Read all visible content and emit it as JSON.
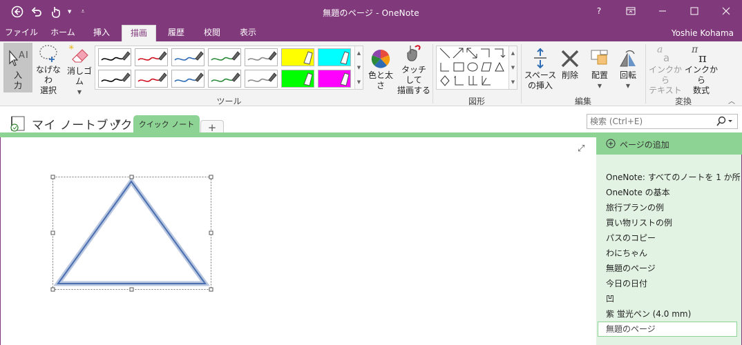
{
  "window": {
    "title": "無題のページ - OneNote",
    "help": "?",
    "restore_ribbon": "□",
    "minimize": "—",
    "maximize": "☐",
    "close": "✕"
  },
  "tabs": [
    {
      "label": "ファイル"
    },
    {
      "label": "ホーム"
    },
    {
      "label": "挿入"
    },
    {
      "label": "描画"
    },
    {
      "label": "履歴"
    },
    {
      "label": "校閲"
    },
    {
      "label": "表示"
    }
  ],
  "user": {
    "name": "Yoshie Kohama"
  },
  "ribbon": {
    "tools": {
      "label": "ツール",
      "input_l1": "入",
      "input_l2": "力",
      "lasso_l1": "なげなわ",
      "lasso_l2": "選択",
      "eraser": "消しゴム",
      "color_thickness": "色と太さ",
      "touch_l1": "タッチして",
      "touch_l2": "描画する",
      "pens": [
        {
          "color": "#000000",
          "type": "pen"
        },
        {
          "color": "#d01020",
          "type": "pen"
        },
        {
          "color": "#2d6bb5",
          "type": "pen"
        },
        {
          "color": "#2a8a3a",
          "type": "pen"
        },
        {
          "color": "#888888",
          "type": "pen"
        },
        {
          "color": "#ffff00",
          "type": "highlighter"
        },
        {
          "color": "#00ffff",
          "type": "highlighter"
        },
        {
          "color": "#000000",
          "type": "pen"
        },
        {
          "color": "#d01020",
          "type": "pen"
        },
        {
          "color": "#2d6bb5",
          "type": "pen"
        },
        {
          "color": "#2a8a3a",
          "type": "pen"
        },
        {
          "color": "#888888",
          "type": "pen"
        },
        {
          "color": "#00ff00",
          "type": "highlighter"
        },
        {
          "color": "#ff00ff",
          "type": "highlighter"
        }
      ]
    },
    "shapes": {
      "label": "図形"
    },
    "edit": {
      "label": "編集",
      "space_l1": "スペース",
      "space_l2": "の挿入",
      "delete": "削除",
      "arrange": "配置",
      "rotate": "回転"
    },
    "convert": {
      "label": "変換",
      "ink_text_l1": "インクから",
      "ink_text_l2": "テキスト",
      "ink_math_l1": "インクから",
      "ink_math_l2": "数式"
    }
  },
  "notebook": {
    "name": "マイ ノートブック",
    "section": "クイック ノート",
    "add_section": "+"
  },
  "search": {
    "placeholder": "検索 (Ctrl+E)"
  },
  "pages": {
    "add_label": "ページの追加",
    "items": [
      "OneNote: すべてのノートを 1 か所",
      "OneNote の基本",
      "旅行プランの例",
      "買い物リストの例",
      "パスのコピー",
      "わにちゃん",
      "無題のページ",
      "今日の日付",
      "凹",
      "紫 蛍光ペン (4.0 mm)"
    ],
    "current": "無題のページ"
  },
  "colors": {
    "accent": "#80397b",
    "section_green": "#8dd394",
    "page_list_bg": "#e3f3e3",
    "triangle_stroke": "#4a6fb0"
  }
}
